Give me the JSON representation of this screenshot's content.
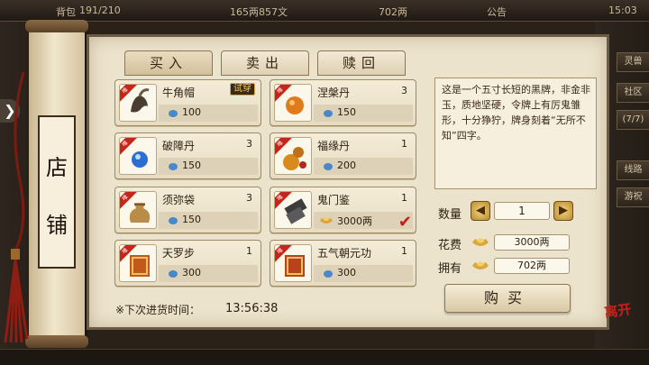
{
  "top_bar": {
    "bag_label": "背包",
    "bag_count": "191/210",
    "money": "165两857文",
    "ingots": "702两",
    "announcement": "公告",
    "time": "15:03"
  },
  "side_buttons": [
    "灵兽",
    "社区",
    "(7/7)",
    "线路",
    "游祝"
  ],
  "scroll_title": [
    "店",
    "铺"
  ],
  "tabs": [
    {
      "label": "买入",
      "active": true
    },
    {
      "label": "卖出",
      "active": false
    },
    {
      "label": "赎回",
      "active": false
    }
  ],
  "items": [
    {
      "name": "牛角帽",
      "count": "",
      "price": "100",
      "tag": "唯",
      "badge": "试穿",
      "icon": "horn-hat-icon",
      "color": "#5a4a3a",
      "selected": false
    },
    {
      "name": "涅槃丹",
      "count": "3",
      "price": "150",
      "tag": "唯",
      "badge": "",
      "icon": "orange-pill-icon",
      "color": "#e07a1a",
      "selected": false
    },
    {
      "name": "破障丹",
      "count": "3",
      "price": "150",
      "tag": "唯",
      "badge": "",
      "icon": "blue-pill-icon",
      "color": "#2a6fd0",
      "selected": false
    },
    {
      "name": "福缘丹",
      "count": "1",
      "price": "200",
      "tag": "唯",
      "badge": "",
      "icon": "gourd-icon",
      "color": "#d98a1c",
      "selected": false
    },
    {
      "name": "须弥袋",
      "count": "3",
      "price": "150",
      "tag": "唯",
      "badge": "",
      "icon": "cloth-bag-icon",
      "color": "#b98c4a",
      "selected": false
    },
    {
      "name": "鬼门鉴",
      "count": "1",
      "price": "3000两",
      "tag": "唯",
      "badge": "",
      "icon": "black-token-icon",
      "color": "#4a4a4a",
      "selected": true
    },
    {
      "name": "天罗步",
      "count": "1",
      "price": "300",
      "tag": "唯",
      "badge": "",
      "icon": "skill-book-icon",
      "color": "#c2591c",
      "selected": false
    },
    {
      "name": "五气朝元功",
      "count": "1",
      "price": "300",
      "tag": "唯",
      "badge": "",
      "icon": "skill-book-icon",
      "color": "#b8421c",
      "selected": false
    }
  ],
  "restock": {
    "label": "※下次进货时间：",
    "time": "13:56:38"
  },
  "description": "这是一个五寸长短的黑牌，非金非玉，质地坚硬，令牌上有厉鬼雏形，十分狰狞，牌身刻着“无所不知”四字。",
  "purchase": {
    "qty_label": "数量",
    "qty_value": "1",
    "cost_label": "花费",
    "cost_value": "3000两",
    "own_label": "拥有",
    "own_value": "702两",
    "buy_label": "购买"
  },
  "close_label": "离开",
  "colors": {
    "parchment": "#ece3cc",
    "accent_red": "#c3201a",
    "gold": "#d9a640"
  }
}
